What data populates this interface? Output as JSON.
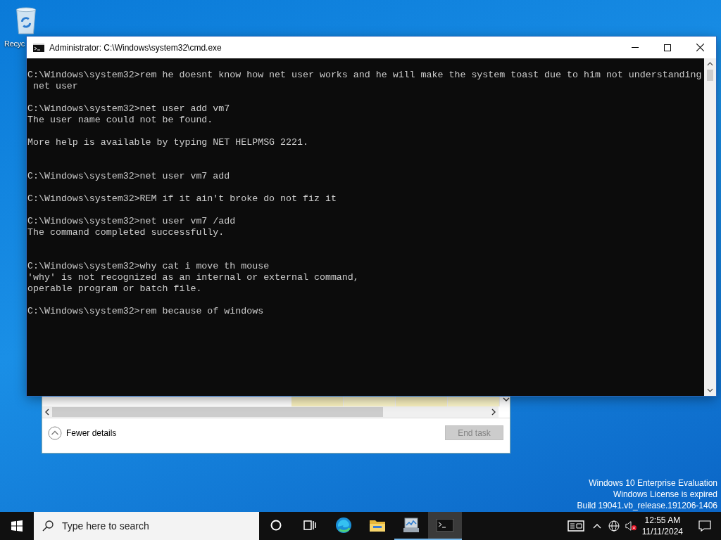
{
  "desktop": {
    "icons": [
      {
        "label": "Recyc"
      }
    ]
  },
  "background_window": {
    "kind": "task-manager",
    "more_button": "Fewer details",
    "end_task": {
      "label": "End task",
      "disabled": true
    }
  },
  "console": {
    "title": "Administrator: C:\\Windows\\system32\\cmd.exe",
    "text": "\nC:\\Windows\\system32>rem he doesnt know how net user works and he will make the system toast due to him not understanding\n net user\n\nC:\\Windows\\system32>net user add vm7\nThe user name could not be found.\n\nMore help is available by typing NET HELPMSG 2221.\n\n\nC:\\Windows\\system32>net user vm7 add\n\nC:\\Windows\\system32>REM if it ain't broke do not fiz it\n\nC:\\Windows\\system32>net user vm7 /add\nThe command completed successfully.\n\n\nC:\\Windows\\system32>why cat i move th mouse\n'why' is not recognized as an internal or external command,\noperable program or batch file.\n\nC:\\Windows\\system32>rem because of windows"
  },
  "watermark_notice": [
    "Windows 10 Enterprise Evaluation",
    "Windows License is expired",
    "Build 19041.vb_release.191206-1406"
  ],
  "taskbar": {
    "search_placeholder": "Type here to search",
    "apps": [
      {
        "kind": "cortana",
        "running": false,
        "selected": false
      },
      {
        "kind": "taskview",
        "running": false,
        "selected": false
      },
      {
        "kind": "edge",
        "running": false,
        "selected": false
      },
      {
        "kind": "explorer",
        "running": false,
        "selected": false
      },
      {
        "kind": "taskmgr",
        "running": true,
        "selected": false
      },
      {
        "kind": "cmd",
        "running": true,
        "selected": true
      }
    ],
    "volume_muted": true,
    "time": "12:55 AM",
    "date": "11/11/2024"
  }
}
